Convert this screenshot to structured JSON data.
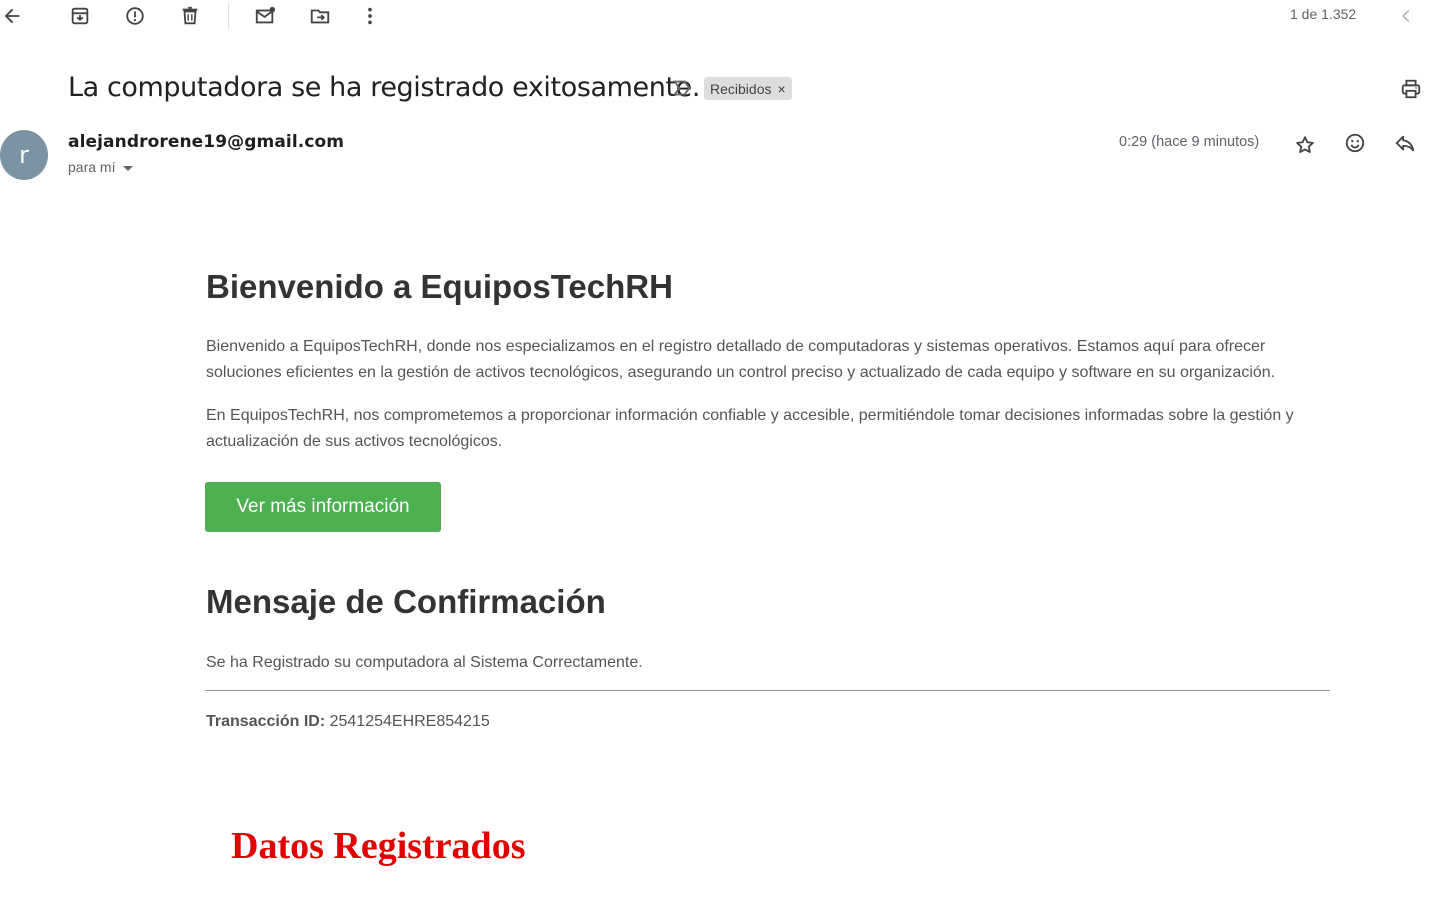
{
  "toolbar": {
    "counter": "1 de 1.352",
    "icons": [
      "back-arrow-icon",
      "archive-icon",
      "report-spam-icon",
      "delete-icon",
      "mark-unread-icon",
      "move-to-icon",
      "more-options-icon",
      "older-chevron-icon"
    ]
  },
  "email": {
    "subject": "La computadora se ha registrado exitosamente.",
    "label": "Recibidos",
    "label_remove": "×",
    "avatar_letter": "r",
    "sender": "alejandrorene19@gmail.com",
    "to": "para mí",
    "time": "0:29 (hace 9 minutos)"
  },
  "content": {
    "welcome_title": "Bienvenido a EquiposTechRH",
    "para1": "Bienvenido a EquiposTechRH, donde nos especializamos en el registro detallado de computadoras y sistemas operativos. Estamos aquí para ofrecer soluciones eficientes en la gestión de activos tecnológicos, asegurando un control preciso y actualizado de cada equipo y software en su organización.",
    "para2": "En EquiposTechRH, nos comprometemos a proporcionar información confiable y accesible, permitiéndole tomar decisiones informadas sobre la gestión y actualización de sus activos tecnológicos.",
    "cta_label": "Ver más información",
    "confirm_title": "Mensaje de Confirmación",
    "confirm_text": "Se ha Registrado su computadora al Sistema Correctamente.",
    "transaction_label": "Transacción ID:",
    "transaction_id": "2541254EHRE854215",
    "datos_title": "Datos Registrados"
  },
  "colors": {
    "cta_green": "#4caf50",
    "datos_red": "#e00000",
    "avatar": "#7b93a3"
  }
}
